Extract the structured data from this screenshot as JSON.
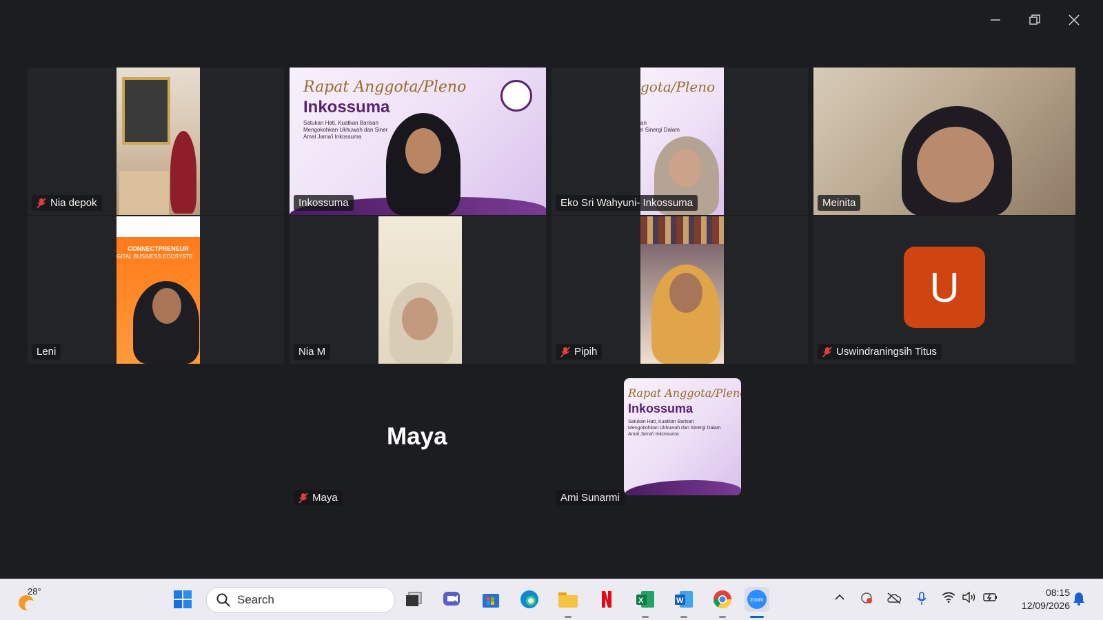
{
  "window_controls": {
    "minimize": "minimize-icon",
    "restore": "restore-icon",
    "close": "close-icon"
  },
  "participants": {
    "nia_depok": {
      "name": "Nia depok",
      "muted": true
    },
    "inkossuma": {
      "name": "Inkossuma",
      "muted": false,
      "active_speaker": true
    },
    "eko": {
      "name": "Eko Sri Wahyuni- Inkossuma",
      "muted": false
    },
    "meinita": {
      "name": "Meinita",
      "muted": false
    },
    "leni": {
      "name": "Leni",
      "muted": false
    },
    "nia_m": {
      "name": "Nia M",
      "muted": false
    },
    "pipih": {
      "name": "Pipih",
      "muted": true
    },
    "uswin": {
      "name": "Uswindraningsih Titus",
      "muted": true,
      "avatar_letter": "U"
    },
    "maya": {
      "name": "Maya",
      "muted": true,
      "display_name": "Maya"
    },
    "ami": {
      "name": "Ami Sunarmi",
      "muted": false
    }
  },
  "slide": {
    "title": "Rapat Anggota/Pleno",
    "title_cropped": "gota/Pleno",
    "org": "Inkossuma",
    "line1": "Satukan Hati, Kuatkan Barisan",
    "line2": "Mengokohkan Ukhuwah dan Sinergi Dalam",
    "line2_cropped": "Mengokohkan Ukhuwah dan Siner",
    "line3": "Amal Jama'i Inkossuma",
    "eko_fragment1": "an",
    "eko_fragment2": "n Sinergi Dalam"
  },
  "leni_banner": {
    "line1": "CONNECTPRENEUR",
    "line2": "GITAL BUSINESS ECOSYSTE"
  },
  "taskbar": {
    "weather_temp": "28°",
    "search_placeholder": "Search",
    "apps": [
      "windows-start",
      "task-view",
      "teams-chat",
      "microsoft-store",
      "edge",
      "file-explorer",
      "netflix",
      "excel",
      "word",
      "chrome",
      "zoom"
    ],
    "time": "08:15",
    "date": "12/09/2026"
  },
  "colors": {
    "accent_active": "#2ecc71",
    "avatar_u": "#d04412",
    "mute_red": "#e0413a"
  }
}
